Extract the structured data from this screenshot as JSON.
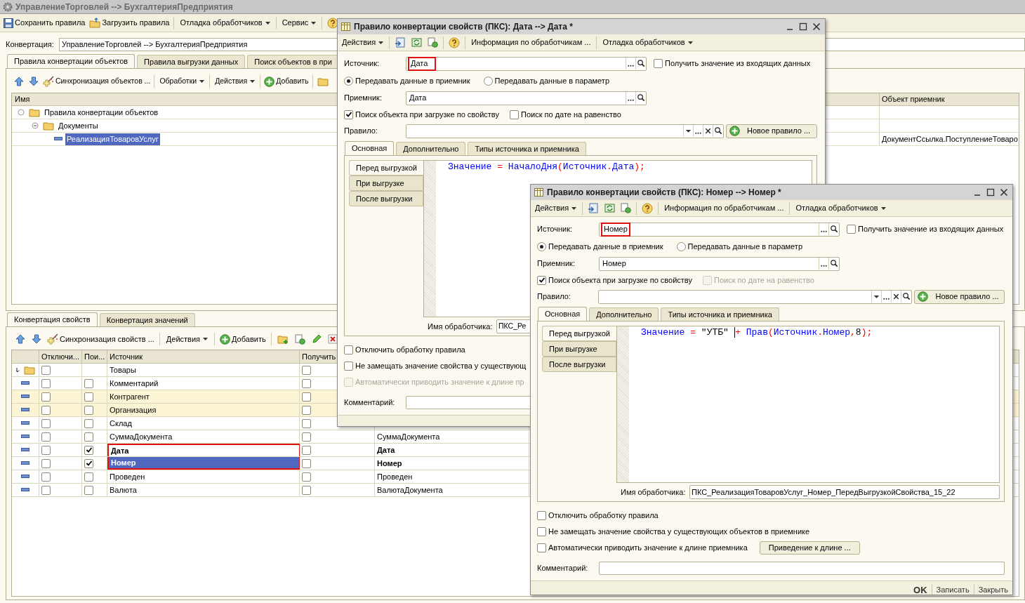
{
  "main_window": {
    "title": "УправлениеТорговлей --> БухгалтерияПредприятия",
    "toolbar": [
      {
        "kind": "save",
        "label": "Сохранить правила"
      },
      {
        "kind": "load",
        "label": "Загрузить правила"
      },
      {
        "kind": "menu",
        "label": "Отладка обработчиков"
      },
      {
        "kind": "menu",
        "label": "Сервис"
      },
      {
        "kind": "help"
      }
    ],
    "conversion_label": "Конвертация:",
    "conversion_value": "УправлениеТорговлей --> БухгалтерияПредприятия",
    "tabs": [
      {
        "label": "Правила конвертации объектов",
        "selected": true
      },
      {
        "label": "Правила выгрузки данных",
        "selected": false
      },
      {
        "label": "Поиск объектов в при",
        "selected": false
      }
    ],
    "rules_toolbar": [
      {
        "kind": "up"
      },
      {
        "kind": "down"
      },
      {
        "kind": "sync",
        "label": "Синхронизация объектов ..."
      },
      {
        "kind": "menu",
        "label": "Обработки"
      },
      {
        "kind": "menu",
        "label": "Действия"
      },
      {
        "kind": "add",
        "label": "Добавить"
      },
      {
        "kind": "folder"
      }
    ],
    "rules_columns": [
      "Имя",
      "Объект приемник"
    ],
    "rules_tree": [
      {
        "label": "Правила конвертации объектов",
        "selected": false,
        "children": [
          {
            "label": "Документы",
            "selected": false,
            "children": [
              {
                "label": "РеализацияТоваровУслуг",
                "selected": true,
                "target": "ДокументСсылка.ПоступлениеТоваро"
              }
            ]
          }
        ]
      }
    ],
    "property_tabs": [
      {
        "label": "Конвертация свойств",
        "selected": true
      },
      {
        "label": "Конвертация значений",
        "selected": false
      }
    ],
    "property_toolbar": [
      {
        "kind": "up"
      },
      {
        "kind": "down"
      },
      {
        "kind": "sync",
        "label": "Синхронизация свойств ..."
      },
      {
        "kind": "menu",
        "label": "Действия"
      },
      {
        "kind": "add",
        "label": "Добавить"
      },
      {
        "kind": "folder-add"
      },
      {
        "kind": "copy"
      },
      {
        "kind": "edit"
      },
      {
        "kind": "delete"
      }
    ],
    "property_columns": [
      "Отключи...",
      "Пои...",
      "Источник",
      "Получить"
    ],
    "property_rows": [
      {
        "kind": "group",
        "source": "Товары",
        "disabled": false,
        "get": false,
        "highlighted": false,
        "selected": false,
        "bold": false,
        "framed": false
      },
      {
        "kind": "property",
        "source": "Комментарий",
        "disabled": false,
        "search": false,
        "get": false,
        "highlighted": false,
        "selected": false,
        "bold": false,
        "framed": false
      },
      {
        "kind": "property",
        "source": "Контрагент",
        "disabled": false,
        "search": false,
        "get": false,
        "highlighted": true,
        "selected": false,
        "bold": false,
        "framed": false
      },
      {
        "kind": "property",
        "source": "Организация",
        "disabled": false,
        "search": false,
        "get": false,
        "highlighted": true,
        "selected": false,
        "bold": false,
        "framed": false
      },
      {
        "kind": "property",
        "source": "Склад",
        "disabled": false,
        "search": false,
        "get": false,
        "highlighted": false,
        "selected": false,
        "bold": false,
        "framed": false
      },
      {
        "kind": "property",
        "source": "СуммаДокумента",
        "disabled": false,
        "search": false,
        "get": false,
        "target": "СуммаДокумента",
        "highlighted": false,
        "selected": false,
        "bold": false,
        "framed": false
      },
      {
        "kind": "property",
        "source": "Дата",
        "disabled": false,
        "search": true,
        "get": false,
        "target": "Дата",
        "highlighted": false,
        "selected": false,
        "bold": true,
        "framed": true
      },
      {
        "kind": "property",
        "source": "Номер",
        "disabled": false,
        "search": true,
        "get": false,
        "target": "Номер",
        "highlighted": false,
        "selected": true,
        "bold": true,
        "framed": true
      },
      {
        "kind": "property",
        "source": "Проведен",
        "disabled": false,
        "search": false,
        "get": false,
        "target": "Проведен",
        "highlighted": false,
        "selected": false,
        "bold": false,
        "framed": false
      },
      {
        "kind": "property",
        "source": "Валюта",
        "disabled": false,
        "search": false,
        "get": false,
        "target": "ВалютаДокумента",
        "highlighted": false,
        "selected": false,
        "bold": false,
        "framed": false
      }
    ]
  },
  "rule_windows": [
    {
      "title": "Правило конвертации свойств (ПКС): Дата --> Дата *",
      "toolbar": [
        {
          "kind": "menu",
          "label": "Действия"
        },
        {
          "kind": "import"
        },
        {
          "kind": "refresh"
        },
        {
          "kind": "copy"
        },
        {
          "kind": "help"
        },
        {
          "kind": "button",
          "label": "Информация по обработчикам ..."
        },
        {
          "kind": "menu",
          "label": "Отладка обработчиков"
        }
      ],
      "source_label": "Источник:",
      "source": "Дата",
      "source_framed": true,
      "incoming": {
        "label": "Получить значение из входящих данных",
        "checked": false
      },
      "transfer": [
        {
          "label": "Передавать данные в приемник",
          "selected": true
        },
        {
          "label": "Передавать данные в параметр",
          "selected": false
        }
      ],
      "target_label": "Приемник:",
      "target": "Дата",
      "search_options": [
        {
          "label": "Поиск объекта при загрузке по свойству",
          "checked": true,
          "disabled": false
        },
        {
          "label": "Поиск по дате на равенство",
          "checked": false,
          "disabled": false
        }
      ],
      "rule_label": "Правило:",
      "new_rule_button": "Новое правило ...",
      "tabs": [
        {
          "label": "Основная",
          "selected": true
        },
        {
          "label": "Дополнительно",
          "selected": false
        },
        {
          "label": "Типы источника и приемника",
          "selected": false
        }
      ],
      "handler_tabs": [
        {
          "label": "Перед выгрузкой",
          "selected": true
        },
        {
          "label": "При выгрузке",
          "selected": false
        },
        {
          "label": "После выгрузки",
          "selected": false
        }
      ],
      "code": [
        {
          "kind": "ident",
          "text": "Значение"
        },
        {
          "kind": "op",
          "text": " = "
        },
        {
          "kind": "ident",
          "text": "НачалоДня"
        },
        {
          "kind": "op",
          "text": "("
        },
        {
          "kind": "ident",
          "text": "Источник"
        },
        {
          "kind": "op",
          "text": "."
        },
        {
          "kind": "ident",
          "text": "Дата"
        },
        {
          "kind": "op",
          "text": ");"
        }
      ],
      "handler_label": "Имя обработчика:",
      "handler_name": "ПКС_Ре",
      "options": [
        {
          "label": "Отключить обработку правила",
          "checked": false,
          "disabled": false
        },
        {
          "label": "Не замещать значение свойства у существующ",
          "checked": false,
          "disabled": false
        },
        {
          "label": "Автоматически приводить значение к длине пр",
          "checked": false,
          "disabled": true
        }
      ],
      "comment_label": "Комментарий:"
    },
    {
      "title": "Правило конвертации свойств (ПКС): Номер --> Номер *",
      "toolbar": [
        {
          "kind": "menu",
          "label": "Действия"
        },
        {
          "kind": "import"
        },
        {
          "kind": "refresh"
        },
        {
          "kind": "copy"
        },
        {
          "kind": "help"
        },
        {
          "kind": "button",
          "label": "Информация по обработчикам ..."
        },
        {
          "kind": "menu",
          "label": "Отладка обработчиков"
        }
      ],
      "source_label": "Источник:",
      "source": "Номер",
      "source_framed": true,
      "incoming": {
        "label": "Получить значение из входящих данных",
        "checked": false
      },
      "transfer": [
        {
          "label": "Передавать данные в приемник",
          "selected": true
        },
        {
          "label": "Передавать данные в параметр",
          "selected": false
        }
      ],
      "target_label": "Приемник:",
      "target": "Номер",
      "search_options": [
        {
          "label": "Поиск объекта при загрузке по свойству",
          "checked": true,
          "disabled": false
        },
        {
          "label": "Поиск по дате на равенство",
          "checked": false,
          "disabled": true
        }
      ],
      "rule_label": "Правило:",
      "new_rule_button": "Новое правило ...",
      "tabs": [
        {
          "label": "Основная",
          "selected": true
        },
        {
          "label": "Дополнительно",
          "selected": false
        },
        {
          "label": "Типы источника и приемника",
          "selected": false
        }
      ],
      "handler_tabs": [
        {
          "label": "Перед выгрузкой",
          "selected": true
        },
        {
          "label": "При выгрузке",
          "selected": false
        },
        {
          "label": "После выгрузки",
          "selected": false
        }
      ],
      "code": [
        {
          "kind": "ident",
          "text": "Значение"
        },
        {
          "kind": "op",
          "text": " = "
        },
        {
          "kind": "literal",
          "text": "\"УТБ\" "
        },
        {
          "kind": "cursor"
        },
        {
          "kind": "op",
          "text": "+ "
        },
        {
          "kind": "ident",
          "text": "Прав"
        },
        {
          "kind": "op",
          "text": "("
        },
        {
          "kind": "ident",
          "text": "Источник"
        },
        {
          "kind": "op",
          "text": "."
        },
        {
          "kind": "ident",
          "text": "Номер"
        },
        {
          "kind": "op",
          "text": ","
        },
        {
          "kind": "literal",
          "text": "8"
        },
        {
          "kind": "op",
          "text": ");"
        }
      ],
      "handler_label": "Имя обработчика:",
      "handler_name": "ПКС_РеализацияТоваровУслуг_Номер_ПередВыгрузкойСвойства_15_22",
      "options": [
        {
          "label": "Отключить обработку правила",
          "checked": false,
          "disabled": false
        },
        {
          "label": "Не замещать значение свойства у существующих объектов в приемнике",
          "checked": false,
          "disabled": false
        },
        {
          "label": "Автоматически приводить значение к длине приемника",
          "checked": false,
          "disabled": false
        }
      ],
      "length_button": "Приведение к длине ...",
      "comment_label": "Комментарий:",
      "footer_buttons": [
        {
          "label": "OK",
          "default": true
        },
        {
          "label": "Записать",
          "default": false
        },
        {
          "label": "Закрыть",
          "default": false
        }
      ]
    }
  ]
}
